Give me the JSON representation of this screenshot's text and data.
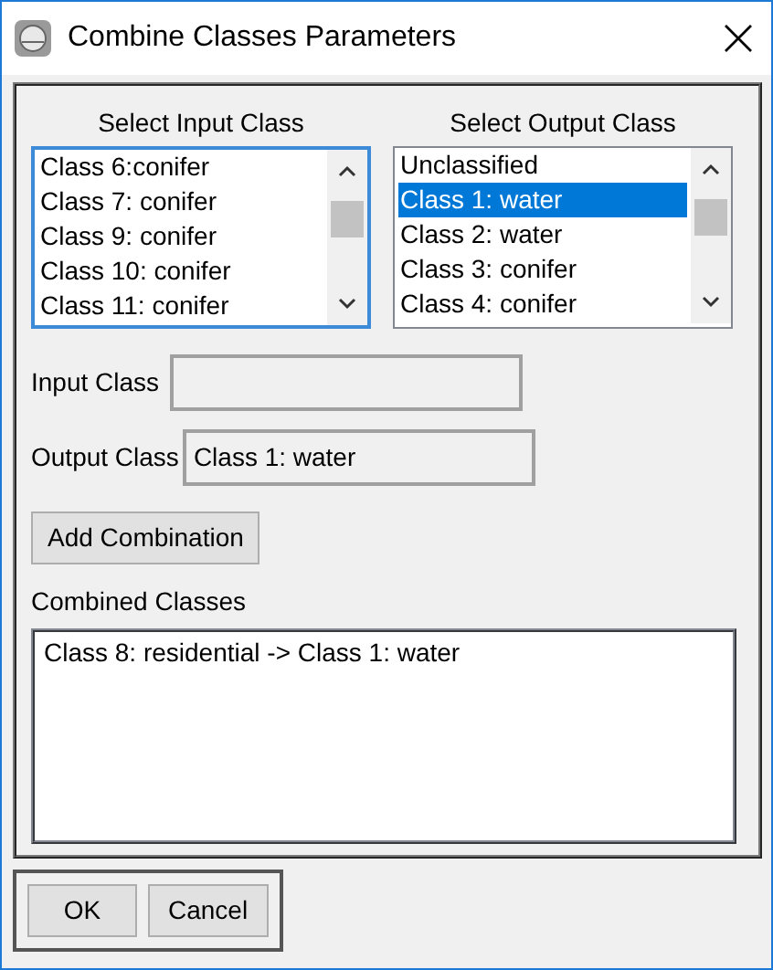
{
  "window": {
    "title": "Combine Classes Parameters"
  },
  "input_list": {
    "heading": "Select Input Class",
    "items": [
      {
        "label": "Class 6:conifer",
        "selected": false
      },
      {
        "label": "Class 7: conifer",
        "selected": false
      },
      {
        "label": "Class 9: conifer",
        "selected": false
      },
      {
        "label": "Class 10: conifer",
        "selected": false
      },
      {
        "label": "Class 11: conifer",
        "selected": false
      }
    ]
  },
  "output_list": {
    "heading": "Select Output Class",
    "items": [
      {
        "label": "Unclassified",
        "selected": false
      },
      {
        "label": "Class 1: water",
        "selected": true
      },
      {
        "label": "Class 2: water",
        "selected": false
      },
      {
        "label": "Class 3: conifer",
        "selected": false
      },
      {
        "label": "Class 4: conifer",
        "selected": false
      }
    ]
  },
  "input_class": {
    "label": "Input Class"
  },
  "output_class": {
    "label": "Output Class",
    "value": "Class 1: water"
  },
  "add_button": "Add Combination",
  "combined": {
    "label": "Combined Classes",
    "items": [
      "Class 8: residential -> Class 1: water"
    ]
  },
  "buttons": [
    "OK",
    "Cancel"
  ]
}
